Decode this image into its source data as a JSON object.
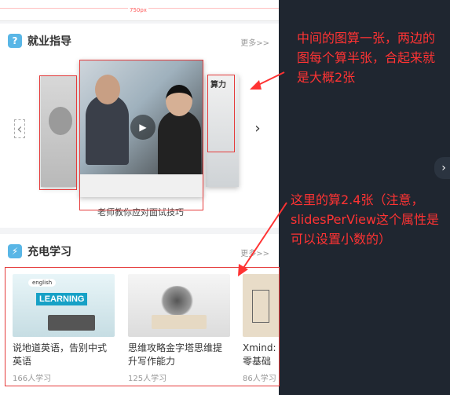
{
  "ruler_label": "750px",
  "section_job": {
    "icon": "question-icon",
    "icon_glyph": "?",
    "title": "就业指导",
    "more": "更多>>",
    "caption": "老师教你应对面试技巧",
    "right_thumb_text": "算力"
  },
  "section_study": {
    "icon": "lightning-icon",
    "icon_glyph": "⚡",
    "title": "充电学习",
    "more": "更多>>",
    "cards": [
      {
        "title": "说地道英语，告别中式英语",
        "count": "166人学习",
        "img_text": "LEARNING",
        "bubble": "english"
      },
      {
        "title": "思维攻略金字塔思维提升写作能力",
        "count": "125人学习"
      },
      {
        "title": "Xmind: 零基础",
        "count": "86人学习"
      }
    ]
  },
  "annotations": {
    "top": "中间的图算一张，两边的图每个算半张，合起来就是大概2张",
    "bottom": "这里的算2.4张（注意，slidesPerView这个属性是可以设置小数的）"
  },
  "colors": {
    "annotation": "#ff3333",
    "accent": "#59b6e6",
    "background": "#1f2630"
  }
}
